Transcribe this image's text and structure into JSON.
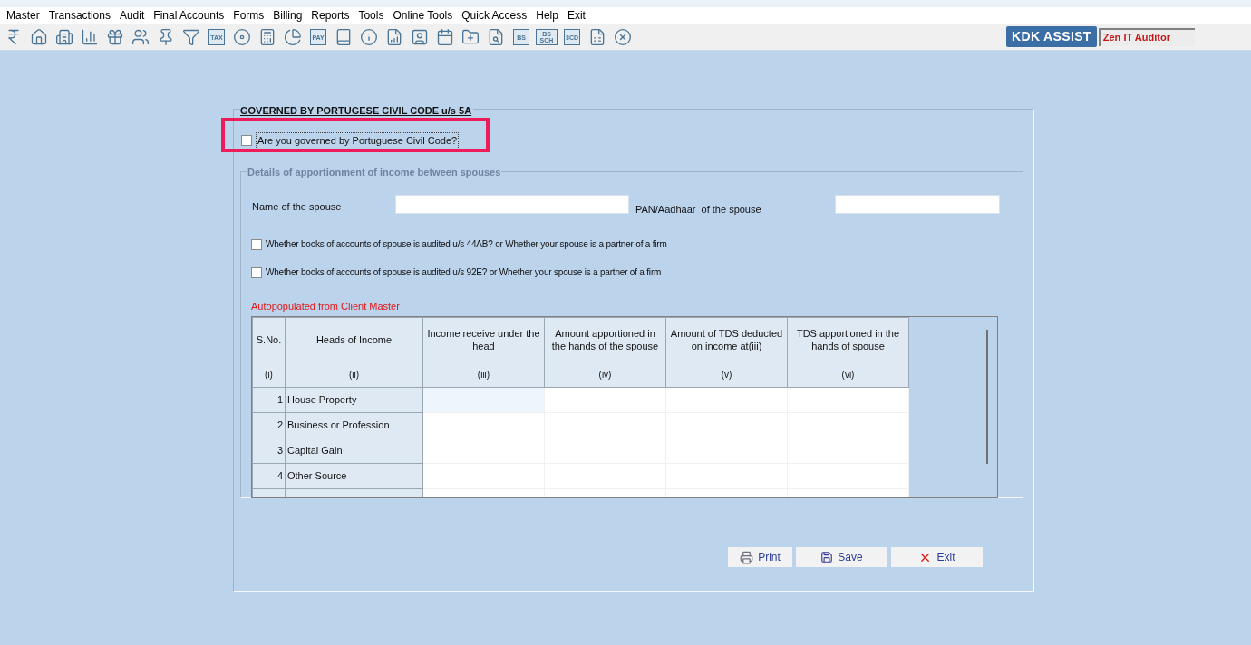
{
  "menu": [
    "Master",
    "Transactions",
    "Audit",
    "Final Accounts",
    "Forms",
    "Billing",
    "Reports",
    "Tools",
    "Online Tools",
    "Quick Access",
    "Help",
    "Exit"
  ],
  "toolbar": [
    {
      "kind": "rupee"
    },
    {
      "kind": "home"
    },
    {
      "kind": "building"
    },
    {
      "kind": "chart"
    },
    {
      "kind": "gift"
    },
    {
      "kind": "users"
    },
    {
      "kind": "pin"
    },
    {
      "kind": "filter"
    },
    {
      "kind": "label",
      "label": "TAX"
    },
    {
      "kind": "disc"
    },
    {
      "kind": "calculator"
    },
    {
      "kind": "pie"
    },
    {
      "kind": "label",
      "label": "PAY"
    },
    {
      "kind": "book"
    },
    {
      "kind": "info"
    },
    {
      "kind": "report"
    },
    {
      "kind": "user-doc"
    },
    {
      "kind": "calendar"
    },
    {
      "kind": "folder"
    },
    {
      "kind": "search-doc"
    },
    {
      "kind": "label",
      "label": "BS"
    },
    {
      "kind": "label",
      "label": "BS SCH"
    },
    {
      "kind": "label",
      "label": "3CD"
    },
    {
      "kind": "sheet"
    },
    {
      "kind": "close"
    }
  ],
  "assist_button": "KDK ASSIST",
  "product_label": "Zen IT Auditor",
  "form": {
    "title": "GOVERNED BY PORTUGESE CIVIL CODE u/s 5A",
    "question": {
      "label": "Are you governed by Portuguese Civil Code?",
      "checked": false,
      "highlighted": true
    },
    "details": {
      "legend": "Details of apportionment of income between spouses",
      "disabled": true,
      "spouse_name_label": "Name of the spouse",
      "pan_label": "PAN/Aadhaar  of the spouse",
      "checks": [
        {
          "label": "Whether books of accounts of spouse is audited u/s 44AB? or Whether your spouse is a partner of a firm",
          "checked": false
        },
        {
          "label": "Whether books of accounts of spouse is audited u/s 92E? or Whether your spouse is a partner of a firm",
          "checked": false
        }
      ],
      "note": "Autopopulated from Client Master",
      "table": {
        "columns": [
          "S.No.",
          "Heads of Income",
          "Income receive under the head",
          "Amount apportioned in the hands of the spouse",
          "Amount of TDS deducted on income at(iii)",
          "TDS apportioned in the hands of spouse"
        ],
        "column_numbers": [
          "(i)",
          "(ii)",
          "(iii)",
          "(iv)",
          "(v)",
          "(vi)"
        ],
        "rows": [
          {
            "sno": "1",
            "head": "House Property"
          },
          {
            "sno": "2",
            "head": "Business or Profession"
          },
          {
            "sno": "3",
            "head": "Capital Gain"
          },
          {
            "sno": "4",
            "head": "Other Source"
          }
        ]
      }
    },
    "buttons": [
      {
        "kind": "print",
        "label": "Print"
      },
      {
        "kind": "save",
        "label": "Save"
      },
      {
        "kind": "exit",
        "label": "Exit"
      }
    ]
  }
}
